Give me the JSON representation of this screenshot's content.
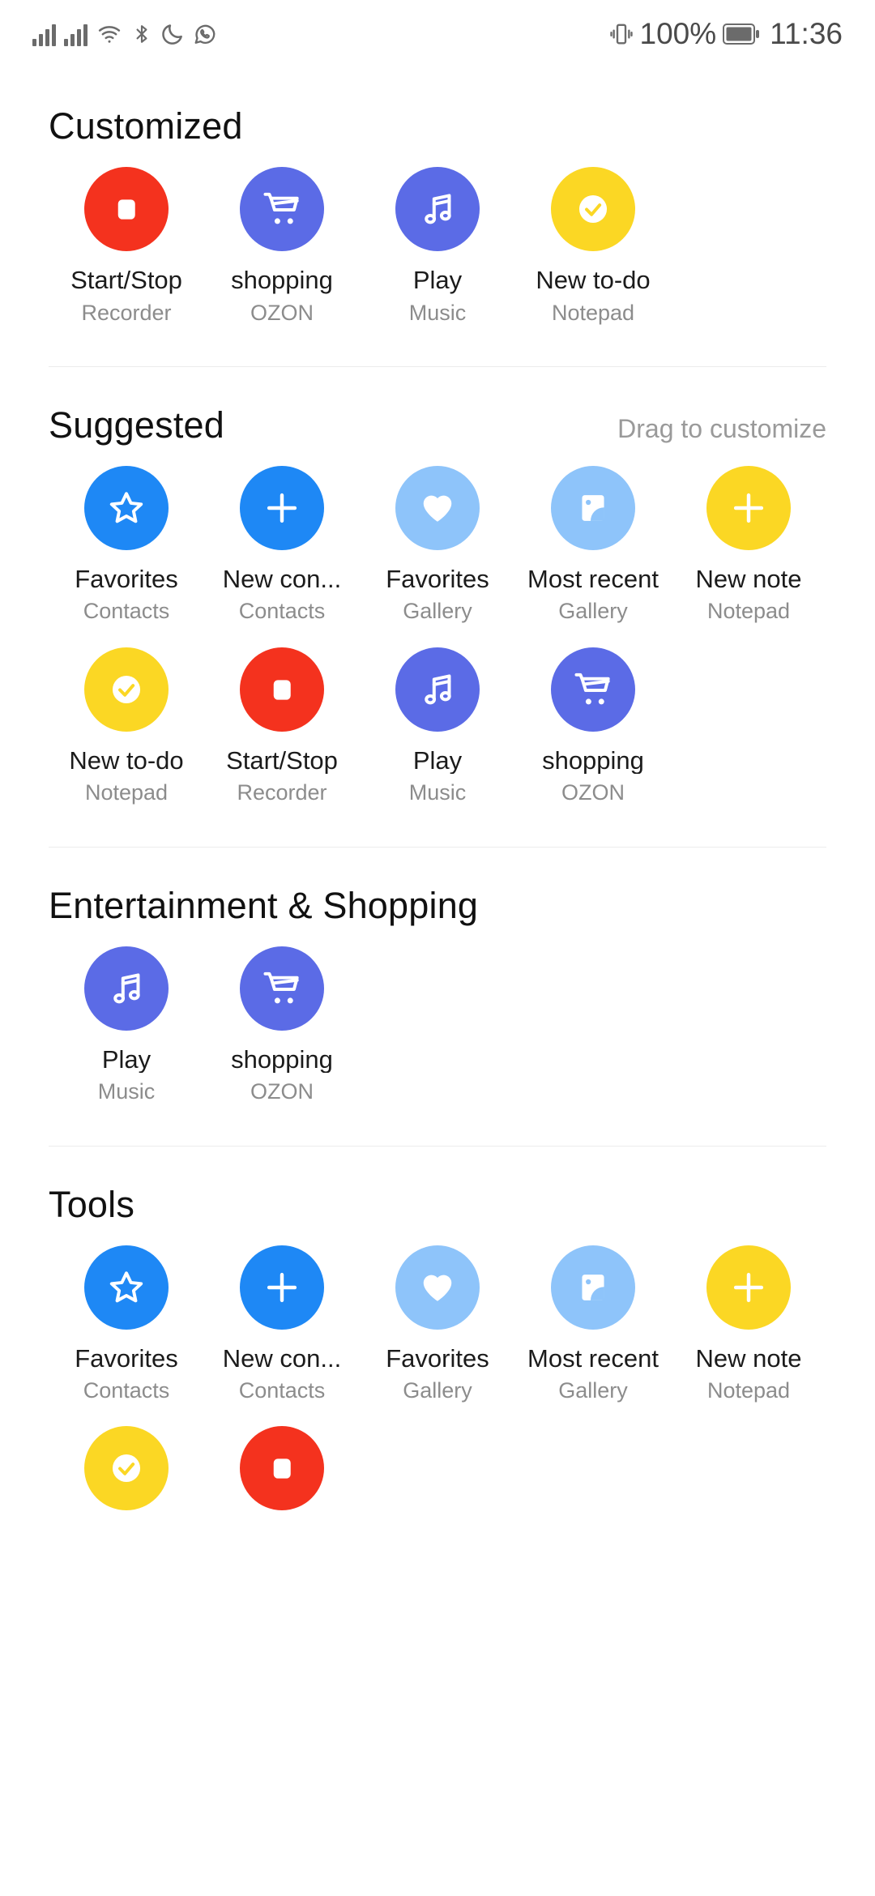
{
  "statusbar": {
    "icons": [
      "signal-bars-icon",
      "signal-bars-icon",
      "wifi-icon",
      "bluetooth-icon",
      "do-not-disturb-moon-icon",
      "whatsapp-icon"
    ],
    "vibrate_icon": "vibrate-icon",
    "battery_percent": "100%",
    "battery_icon": "battery-full-icon",
    "time": "11:36"
  },
  "colors": {
    "recorder_red": "#F4321E",
    "ozon_purple": "#5B6BE6",
    "music_purple": "#5B6BE6",
    "notepad_yellow": "#FBD724",
    "contacts_blue": "#1E88F5",
    "gallery_light_blue": "#8EC4FA",
    "label_text": "#1b1b1b",
    "sub_text": "#8c8c8c",
    "hint_text": "#9a9a9a",
    "divider": "#ececec"
  },
  "sections": [
    {
      "title": "Customized",
      "hint": "",
      "items": [
        {
          "label": "Start/Stop",
          "app": "Recorder",
          "icon": "stop-square-icon",
          "color": "#F4321E"
        },
        {
          "label": "shopping",
          "app": "OZON",
          "icon": "shopping-cart-icon",
          "color": "#5B6BE6"
        },
        {
          "label": "Play",
          "app": "Music",
          "icon": "music-note-icon",
          "color": "#5B6BE6"
        },
        {
          "label": "New to-do",
          "app": "Notepad",
          "icon": "check-circle-icon",
          "color": "#FBD724"
        }
      ]
    },
    {
      "title": "Suggested",
      "hint": "Drag to customize",
      "items": [
        {
          "label": "Favorites",
          "app": "Contacts",
          "icon": "star-outline-icon",
          "color": "#1E88F5"
        },
        {
          "label": "New con...",
          "app": "Contacts",
          "icon": "plus-icon",
          "color": "#1E88F5"
        },
        {
          "label": "Favorites",
          "app": "Gallery",
          "icon": "heart-icon",
          "color": "#8EC4FA"
        },
        {
          "label": "Most recent",
          "app": "Gallery",
          "icon": "picture-icon",
          "color": "#8EC4FA"
        },
        {
          "label": "New note",
          "app": "Notepad",
          "icon": "plus-icon",
          "color": "#FBD724"
        },
        {
          "label": "New to-do",
          "app": "Notepad",
          "icon": "check-circle-icon",
          "color": "#FBD724"
        },
        {
          "label": "Start/Stop",
          "app": "Recorder",
          "icon": "stop-square-icon",
          "color": "#F4321E"
        },
        {
          "label": "Play",
          "app": "Music",
          "icon": "music-note-icon",
          "color": "#5B6BE6"
        },
        {
          "label": "shopping",
          "app": "OZON",
          "icon": "shopping-cart-icon",
          "color": "#5B6BE6"
        }
      ]
    },
    {
      "title": "Entertainment & Shopping",
      "hint": "",
      "items": [
        {
          "label": "Play",
          "app": "Music",
          "icon": "music-note-icon",
          "color": "#5B6BE6"
        },
        {
          "label": "shopping",
          "app": "OZON",
          "icon": "shopping-cart-icon",
          "color": "#5B6BE6"
        }
      ]
    },
    {
      "title": "Tools",
      "hint": "",
      "items": [
        {
          "label": "Favorites",
          "app": "Contacts",
          "icon": "star-outline-icon",
          "color": "#1E88F5"
        },
        {
          "label": "New con...",
          "app": "Contacts",
          "icon": "plus-icon",
          "color": "#1E88F5"
        },
        {
          "label": "Favorites",
          "app": "Gallery",
          "icon": "heart-icon",
          "color": "#8EC4FA"
        },
        {
          "label": "Most recent",
          "app": "Gallery",
          "icon": "picture-icon",
          "color": "#8EC4FA"
        },
        {
          "label": "New note",
          "app": "Notepad",
          "icon": "plus-icon",
          "color": "#FBD724"
        },
        {
          "label": "",
          "app": "",
          "icon": "check-circle-icon",
          "color": "#FBD724"
        },
        {
          "label": "",
          "app": "",
          "icon": "stop-square-icon",
          "color": "#F4321E"
        }
      ]
    }
  ]
}
